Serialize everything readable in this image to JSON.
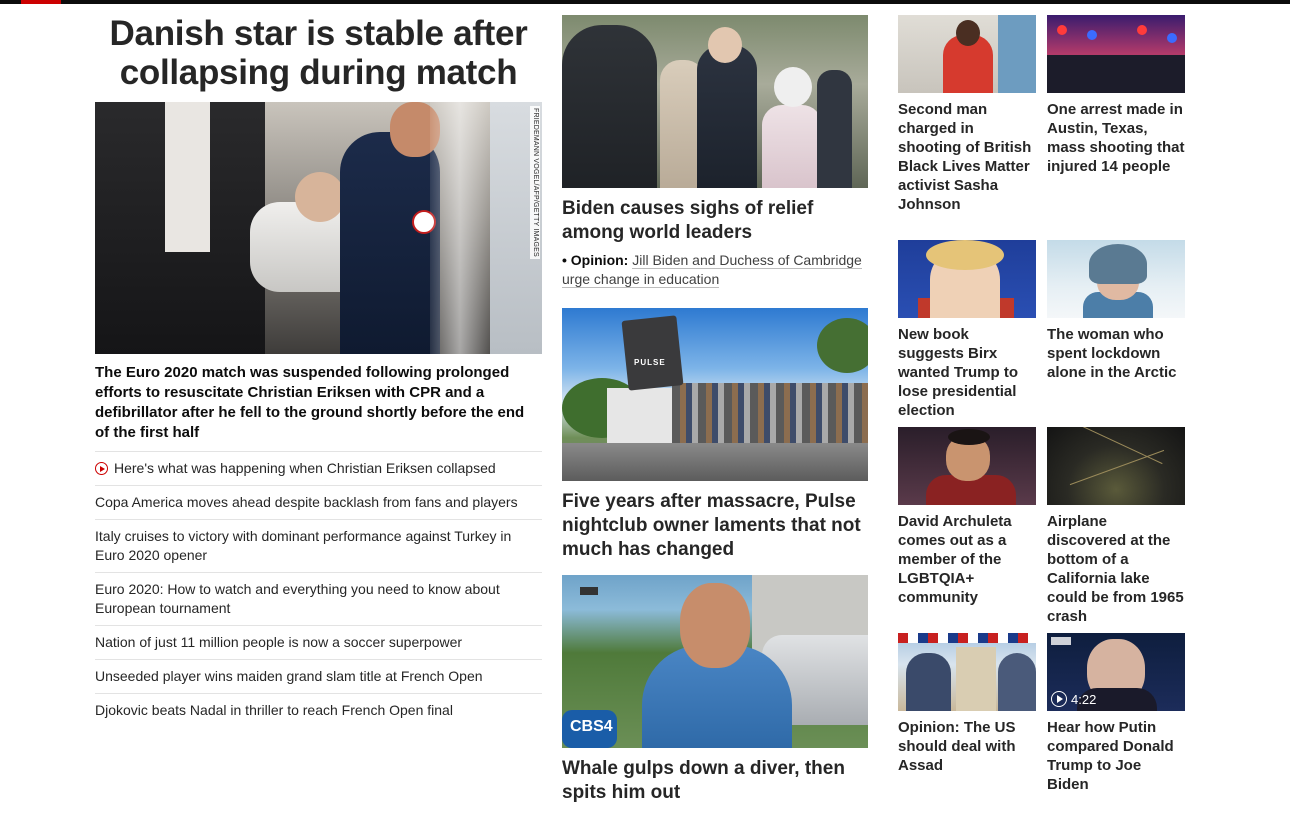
{
  "main": {
    "headline": "Danish star is stable after collapsing during match",
    "image_credit": "FRIEDEMANN VOGEL/AFP/GETTY IMAGES",
    "summary": "The Euro 2020 match was suspended following prolonged efforts to resuscitate Christian Eriksen with CPR and a defibrillator after he fell to the ground shortly before the end of the first half",
    "related": [
      {
        "text": "Here's what was happening when Christian Eriksen collapsed",
        "icon": "play-video-icon"
      },
      {
        "text": "Copa America moves ahead despite backlash from fans and players"
      },
      {
        "text": "Italy cruises to victory with dominant performance against Turkey in Euro 2020 opener"
      },
      {
        "text": "Euro 2020: How to watch and everything you need to know about European tournament"
      },
      {
        "text": "Nation of just 11 million people is now a soccer superpower"
      },
      {
        "text": "Unseeded player wins maiden grand slam title at French Open"
      },
      {
        "text": "Djokovic beats Nadal in thriller to reach French Open final"
      }
    ]
  },
  "middle": {
    "stories": [
      {
        "title": "Biden causes sighs of relief among world leaders",
        "opinion_bullet": "•",
        "opinion_label": "Opinion:",
        "opinion_text": "Jill Biden and Duchess of Cambridge urge change in education"
      },
      {
        "title": "Five years after massacre, Pulse nightclub owner laments that not much has changed",
        "sign_text": "PULSE"
      },
      {
        "title": "Whale gulps down a diver, then spits him out",
        "mic_text": "CBS4"
      }
    ]
  },
  "grid": {
    "tiles": [
      {
        "title": "Second man charged in shooting of British Black Lives Matter activist Sasha Johnson"
      },
      {
        "title": "One arrest made in Austin, Texas, mass shooting that injured 14 people"
      },
      {
        "title": "New book suggests Birx wanted Trump to lose presidential election"
      },
      {
        "title": "The woman who spent lockdown alone in the Arctic"
      },
      {
        "title": "David Archuleta comes out as a member of the LGBTQIA+ community"
      },
      {
        "title": "Airplane discovered at the bottom of a California lake could be from 1965 crash"
      },
      {
        "title": "Opinion: The US should deal with Assad"
      },
      {
        "title": "Hear how Putin compared Donald Trump to Joe Biden",
        "duration": "4:22"
      }
    ]
  },
  "colors": {
    "accent": "#cc0000",
    "text": "#262626",
    "divider": "#e3e3e3"
  }
}
